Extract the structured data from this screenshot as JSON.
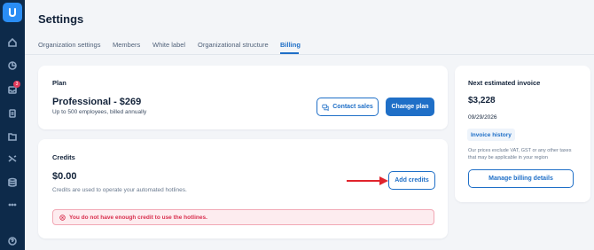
{
  "sidebar": {
    "notification_count": "3",
    "items": [
      {
        "icon": "home-icon"
      },
      {
        "icon": "analytics-icon"
      },
      {
        "icon": "inbox-icon"
      },
      {
        "icon": "clipboard-icon"
      },
      {
        "icon": "folder-icon"
      },
      {
        "icon": "routing-icon"
      },
      {
        "icon": "database-icon"
      },
      {
        "icon": "more-icon"
      },
      {
        "icon": "help-icon"
      }
    ]
  },
  "header": {
    "title": "Settings",
    "tabs": [
      {
        "label": "Organization settings"
      },
      {
        "label": "Members"
      },
      {
        "label": "White label"
      },
      {
        "label": "Organizational structure"
      },
      {
        "label": "Billing"
      }
    ],
    "active_tab": "Billing"
  },
  "plan": {
    "title": "Plan",
    "name": "Professional - $269",
    "description": "Up to 500 employees, billed annually",
    "contact_sales_label": "Contact sales",
    "change_plan_label": "Change plan"
  },
  "credits": {
    "title": "Credits",
    "amount": "$0.00",
    "description": "Credits are used to operate your automated hotlines.",
    "add_credits_label": "Add credits",
    "alert": "You do not have enough credit to use the hotlines."
  },
  "invoice": {
    "title": "Next estimated invoice",
    "amount": "$3,228",
    "date": "09/29/2026",
    "history_label": "Invoice history",
    "note": "Our prices exclude VAT, GST or any other taxes that may be applicable in your region",
    "manage_label": "Manage billing details"
  },
  "colors": {
    "sidebar": "#0d2a4a",
    "accent": "#1f6fc7",
    "alert": "#d9304f",
    "annotation_arrow": "#e0242c"
  }
}
